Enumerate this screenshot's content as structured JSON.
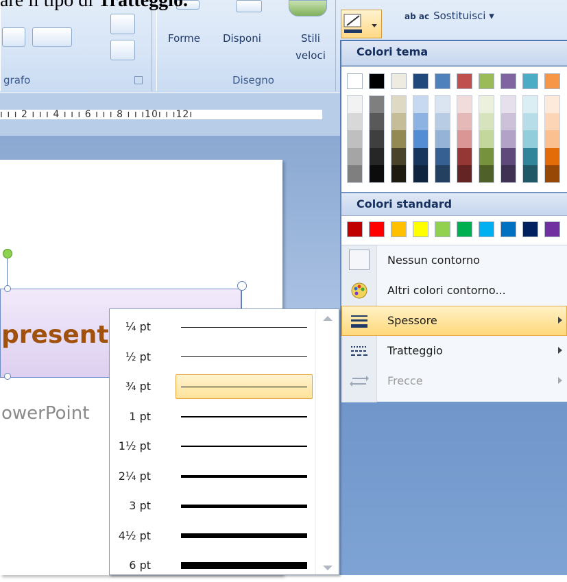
{
  "doc_instruction": {
    "prefix": "are il tipo di ",
    "bold": "Tratteggio",
    "suffix": "."
  },
  "ribbon": {
    "group_paragraph_label": "grafo",
    "group_draw_label": "Disegno",
    "shapes_label": "Forme",
    "arrange_label": "Disponi",
    "quick_styles_label_1": "Stili",
    "quick_styles_label_2": "veloci",
    "replace_label": "Sostituisci",
    "replace_icon_text": "ab ac"
  },
  "ruler": {
    "text": "ı ı ı 2 ı ı ı 4 ı ı ı 6 ı ı ı 8 ı ı ı10ı ı ı12ı"
  },
  "slide": {
    "shape_text": "present",
    "subtitle_text": "owerPoint"
  },
  "color_menu": {
    "theme_title": "Colori tema",
    "standard_title": "Colori standard",
    "theme_colors": [
      "#ffffff",
      "#000000",
      "#eeece1",
      "#1f497d",
      "#4f81bd",
      "#c0504d",
      "#9bbb59",
      "#8064a2",
      "#4bacc6",
      "#f79646"
    ],
    "theme_shades": [
      [
        "#f2f2f2",
        "#d8d8d8",
        "#bfbfbf",
        "#a5a5a5",
        "#7f7f7f"
      ],
      [
        "#7f7f7f",
        "#595959",
        "#3f3f3f",
        "#262626",
        "#0c0c0c"
      ],
      [
        "#ddd9c3",
        "#c4bd97",
        "#938953",
        "#494429",
        "#1d1b10"
      ],
      [
        "#c6d9f0",
        "#8db3e2",
        "#548dd4",
        "#17365d",
        "#0f243e"
      ],
      [
        "#dbe5f1",
        "#b8cce4",
        "#95b3d7",
        "#366092",
        "#244061"
      ],
      [
        "#f2dcdb",
        "#e5b9b7",
        "#d99694",
        "#953734",
        "#632423"
      ],
      [
        "#ebf1dd",
        "#d7e3bc",
        "#c3d69b",
        "#76923c",
        "#4f6128"
      ],
      [
        "#e5e0ec",
        "#ccc1d9",
        "#b2a2c7",
        "#5f497a",
        "#3f3151"
      ],
      [
        "#dbeef3",
        "#b7dde8",
        "#92cddc",
        "#31859b",
        "#205867"
      ],
      [
        "#fdeada",
        "#fbd5b5",
        "#fac08f",
        "#e36c09",
        "#974806"
      ]
    ],
    "standard_colors": [
      "#c00000",
      "#ff0000",
      "#ffc000",
      "#ffff00",
      "#92d050",
      "#00b050",
      "#00b0f0",
      "#0070c0",
      "#002060",
      "#7030a0"
    ],
    "items": [
      {
        "label": "Nessun contorno",
        "icon": "no-outline-icon"
      },
      {
        "label": "Altri colori contorno...",
        "icon": "palette-icon"
      },
      {
        "label": "Spessore",
        "icon": "line-weight-icon"
      },
      {
        "label": "Tratteggio",
        "icon": "dash-style-icon"
      },
      {
        "label": "Frecce",
        "icon": "arrows-icon"
      }
    ]
  },
  "weights": {
    "items": [
      {
        "label": "¼ pt",
        "thickness_pt": 0.25
      },
      {
        "label": "½ pt",
        "thickness_pt": 0.5
      },
      {
        "label": "¾ pt",
        "thickness_pt": 0.75
      },
      {
        "label": "1 pt",
        "thickness_pt": 1
      },
      {
        "label": "1½ pt",
        "thickness_pt": 1.5
      },
      {
        "label": "2¼ pt",
        "thickness_pt": 2.25
      },
      {
        "label": "3 pt",
        "thickness_pt": 3
      },
      {
        "label": "4½ pt",
        "thickness_pt": 4.5
      },
      {
        "label": "6 pt",
        "thickness_pt": 6
      }
    ],
    "selected": "¾ pt"
  }
}
